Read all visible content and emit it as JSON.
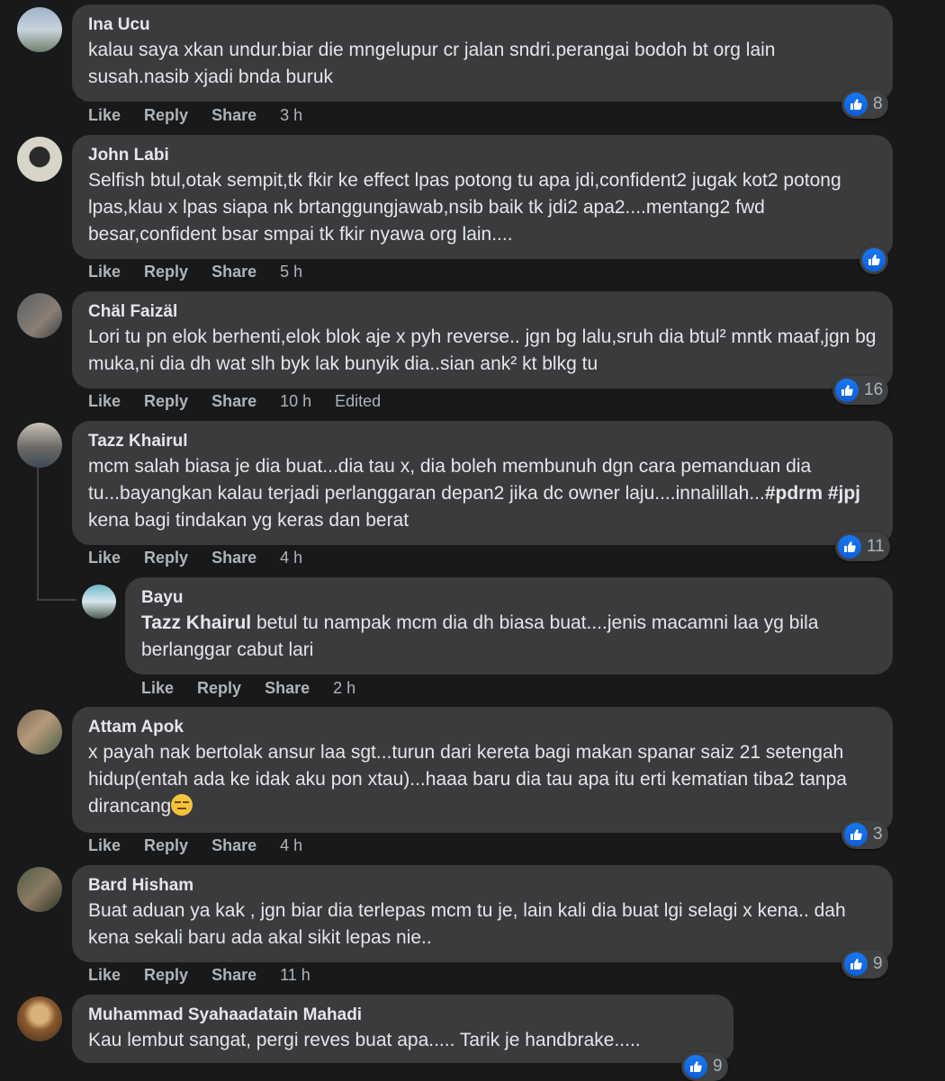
{
  "actions": {
    "like": "Like",
    "reply": "Reply",
    "share": "Share",
    "edited": "Edited"
  },
  "colors": {
    "background": "#18191a",
    "bubble": "#3a3b3c",
    "like_blue": "#1877f2",
    "meta": "#b0b3b8"
  },
  "comments": [
    {
      "author": "Ina Ucu",
      "text": "kalau saya xkan undur.biar die mngelupur cr jalan sndri.perangai bodoh bt org lain susah.nasib xjadi bnda buruk",
      "time": "3 h",
      "reactions": "8"
    },
    {
      "author": "John Labi",
      "text": "Selfish btul,otak sempit,tk fkir ke effect lpas potong tu apa jdi,confident2 jugak kot2 potong lpas,klau x lpas siapa nk brtanggungjawab,nsib baik tk jdi2 apa2....mentang2 fwd besar,confident bsar smpai tk fkir nyawa org lain....",
      "time": "5 h",
      "reactions": ""
    },
    {
      "author": "Chäl Faizäl",
      "text": "Lori tu pn elok berhenti,elok blok aje x pyh reverse.. jgn bg lalu,sruh dia btul² mntk maaf,jgn bg muka,ni dia dh wat slh byk lak bunyik dia..sian ank² kt blkg tu",
      "time": "10 h",
      "reactions": "16"
    },
    {
      "author": "Tazz Khairul",
      "text_a": "mcm salah biasa je dia buat...dia tau x, dia boleh membunuh dgn cara pemanduan dia tu...bayangkan kalau terjadi perlanggaran depan2 jika dc owner laju....innalillah...",
      "tags": "#pdrm #jpj",
      "text_b": " kena bagi tindakan yg keras dan berat",
      "time": "4 h",
      "reactions": "11"
    },
    {
      "author": "Bayu",
      "mention": "Tazz Khairul",
      "text": " betul tu nampak mcm dia dh biasa buat....jenis macamni laa yg bila berlanggar cabut lari",
      "time": "2 h"
    },
    {
      "author": "Attam Apok",
      "text": "x payah nak bertolak ansur laa sgt...turun dari kereta bagi makan spanar saiz 21 setengah hidup(entah ada ke idak aku pon xtau)...haaa baru dia tau apa itu erti kematian tiba2 tanpa dirancang",
      "time": "4 h",
      "reactions": "3"
    },
    {
      "author": "Bard Hisham",
      "text": "Buat aduan ya kak , jgn biar dia terlepas mcm tu je, lain kali dia buat lgi selagi x kena.. dah kena sekali baru ada akal sikit lepas nie..",
      "time": "11 h",
      "reactions": "9"
    },
    {
      "author": "Muhammad Syahaadatain Mahadi",
      "text": "Kau lembut sangat, pergi reves buat apa..... Tarik je handbrake.....",
      "reactions": "9"
    }
  ]
}
